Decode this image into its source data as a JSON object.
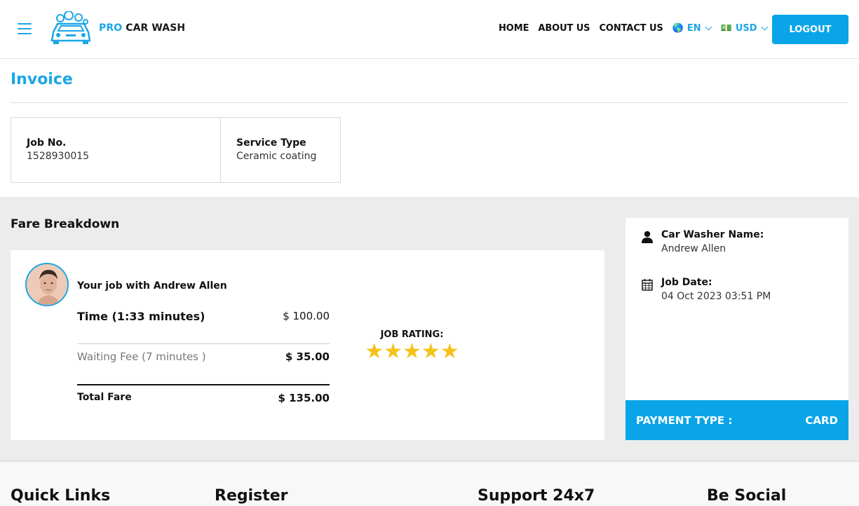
{
  "header": {
    "logo": {
      "pro": "PRO",
      "rest": " CAR WASH"
    },
    "nav": [
      "HOME",
      "ABOUT US",
      "CONTACT US"
    ],
    "language": {
      "flag": "🌎",
      "label": "EN"
    },
    "currency": {
      "flag": "💵",
      "label": "USD"
    },
    "logout_label": "LOGOUT"
  },
  "invoice": {
    "title": "Invoice",
    "job_no_label": "Job No.",
    "job_no": "1528930015",
    "service_type_label": "Service Type",
    "service_type": "Ceramic coating"
  },
  "fare": {
    "title": "Fare Breakdown",
    "job_with": "Your job with Andrew Allen",
    "time_label": "Time (1:33 minutes)",
    "time_amount": "$ 100.00",
    "waiting_label": "Waiting Fee (7 minutes )",
    "waiting_amount": "$ 35.00",
    "total_label": "Total Fare",
    "total_amount": "$ 135.00",
    "rating_label": "JOB RATING:",
    "rating_value": 5,
    "rating_max": 5
  },
  "details": {
    "washer_label": "Car Washer Name:",
    "washer_name": "Andrew Allen",
    "date_label": "Job Date:",
    "date_value": "04 Oct 2023 03:51 PM",
    "payment_label": "PAYMENT TYPE :",
    "payment_value": "CARD"
  },
  "footer": {
    "headings": [
      "Quick Links",
      "Register",
      "Support 24x7",
      "Be Social"
    ]
  },
  "colors": {
    "accent": "#0aa5e9",
    "star": "#f5c21a",
    "grey_bg": "#ececec"
  }
}
